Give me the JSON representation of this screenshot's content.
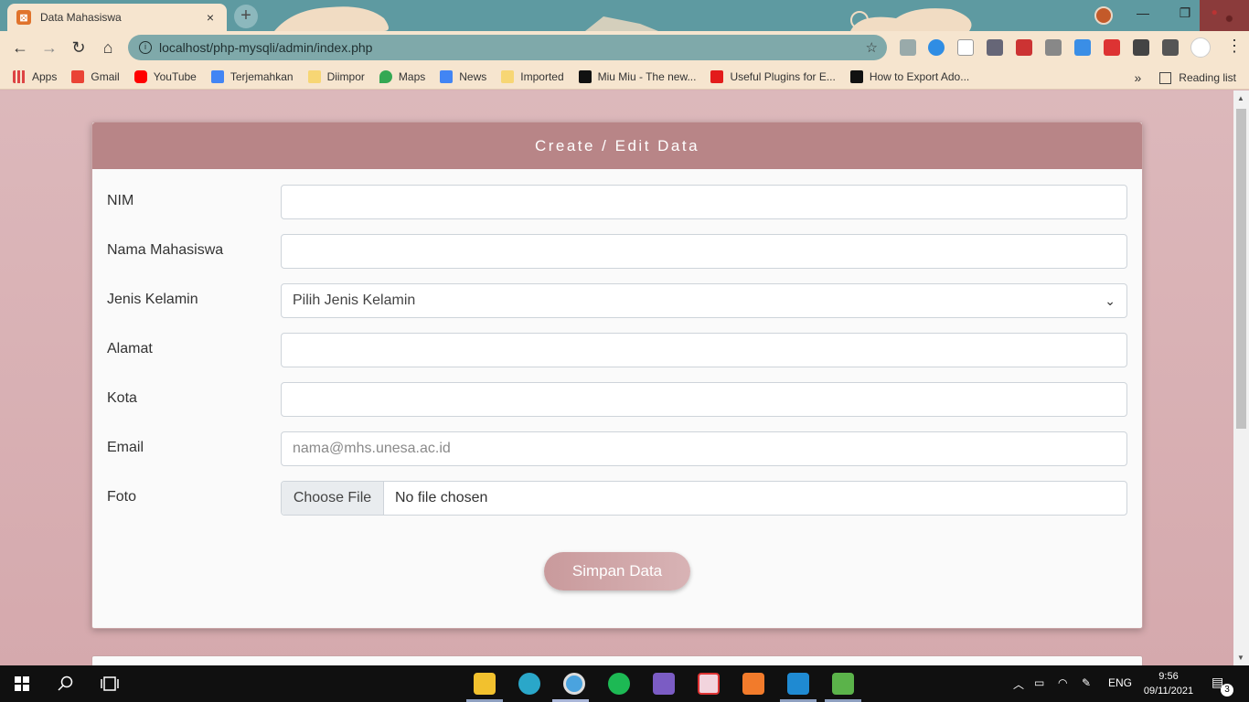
{
  "browser": {
    "tab_title": "Data Mahasiswa",
    "tab_close": "×",
    "new_tab": "+",
    "url": "localhost/php-mysqli/admin/index.php",
    "window_controls": {
      "minimize": "—",
      "restore": "❐"
    }
  },
  "bookmarks": {
    "items": [
      {
        "label": "Apps",
        "color": "#d44"
      },
      {
        "label": "Gmail",
        "color": "#ea4335"
      },
      {
        "label": "YouTube",
        "color": "#ff0000"
      },
      {
        "label": "Terjemahkan",
        "color": "#4285f4"
      },
      {
        "label": "Diimpor",
        "color": "#f7d674"
      },
      {
        "label": "Maps",
        "color": "#34a853"
      },
      {
        "label": "News",
        "color": "#4285f4"
      },
      {
        "label": "Imported",
        "color": "#f7d674"
      },
      {
        "label": "Miu Miu - The new...",
        "color": "#111"
      },
      {
        "label": "Useful Plugins for E...",
        "color": "#e31b1b"
      },
      {
        "label": "How to Export Ado...",
        "color": "#111"
      }
    ],
    "more": "»",
    "reading_list": "Reading list"
  },
  "form": {
    "title": "Create / Edit Data",
    "fields": {
      "nim": {
        "label": "NIM",
        "value": ""
      },
      "nama": {
        "label": "Nama Mahasiswa",
        "value": ""
      },
      "jk": {
        "label": "Jenis Kelamin",
        "selected": "Pilih Jenis Kelamin"
      },
      "alamat": {
        "label": "Alamat",
        "value": ""
      },
      "kota": {
        "label": "Kota",
        "value": ""
      },
      "email": {
        "label": "Email",
        "placeholder": "nama@mhs.unesa.ac.id"
      },
      "foto": {
        "label": "Foto",
        "button": "Choose File",
        "status": "No file chosen"
      }
    },
    "submit": "Simpan Data"
  },
  "taskbar": {
    "language": "ENG",
    "time": "9:56",
    "date": "09/11/2021",
    "notification_count": "3"
  },
  "colors": {
    "header": "#b88587",
    "accent": "#d8b3b5",
    "tab_bg": "#f6e5cf",
    "frame": "#5e9aa1"
  }
}
